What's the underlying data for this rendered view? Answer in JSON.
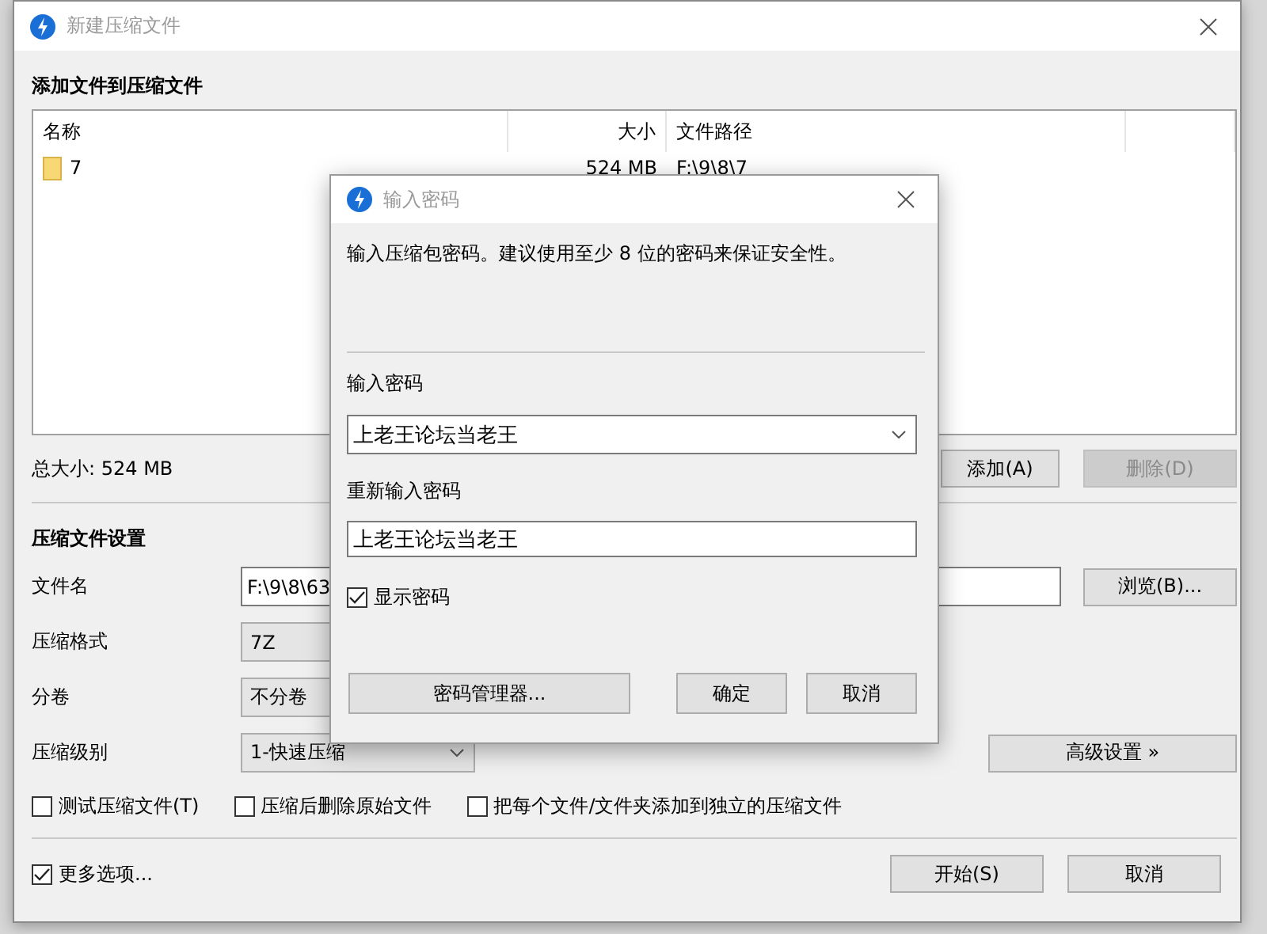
{
  "window": {
    "title": "新建压缩文件"
  },
  "files": {
    "heading": "添加文件到压缩文件",
    "columns": [
      "名称",
      "大小",
      "文件路径"
    ],
    "rows": [
      {
        "name": "7",
        "size": "524 MB",
        "path": "F:\\9\\8\\7"
      }
    ],
    "total": "总大小: 524 MB",
    "buttons": [
      {
        "label": "添加(A)",
        "disabled": false
      },
      {
        "label": "删除(D)",
        "disabled": true
      }
    ]
  },
  "settings": {
    "heading": "压缩文件设置",
    "fields": [
      {
        "kind": "text",
        "label": "文件名",
        "value": "F:\\9\\8\\63",
        "button": "浏览(B)..."
      },
      {
        "kind": "select",
        "label": "压缩格式",
        "value": "7Z"
      },
      {
        "kind": "select",
        "label": "分卷",
        "value": "不分卷"
      },
      {
        "kind": "select",
        "label": "压缩级别",
        "value": "1-快速压缩",
        "button": "高级设置 »"
      }
    ],
    "options": [
      {
        "label": "测试压缩文件(T)",
        "checked": false
      },
      {
        "label": "压缩后删除原始文件",
        "checked": false
      },
      {
        "label": "把每个文件/文件夹添加到独立的压缩文件",
        "checked": false
      }
    ]
  },
  "footer": {
    "more": {
      "label": "更多选项...",
      "checked": true
    },
    "buttons": [
      "开始(S)",
      "取消"
    ]
  },
  "password_dialog": {
    "title": "输入密码",
    "hint": "输入压缩包密码。建议使用至少 8 位的密码来保证安全性。",
    "password_label": "输入密码",
    "password": "上老王论坛当老王",
    "confirm_label": "重新输入密码",
    "confirm": "上老王论坛当老王",
    "show": {
      "label": "显示密码",
      "checked": true
    },
    "buttons": [
      "密码管理器...",
      "确定",
      "取消"
    ]
  }
}
